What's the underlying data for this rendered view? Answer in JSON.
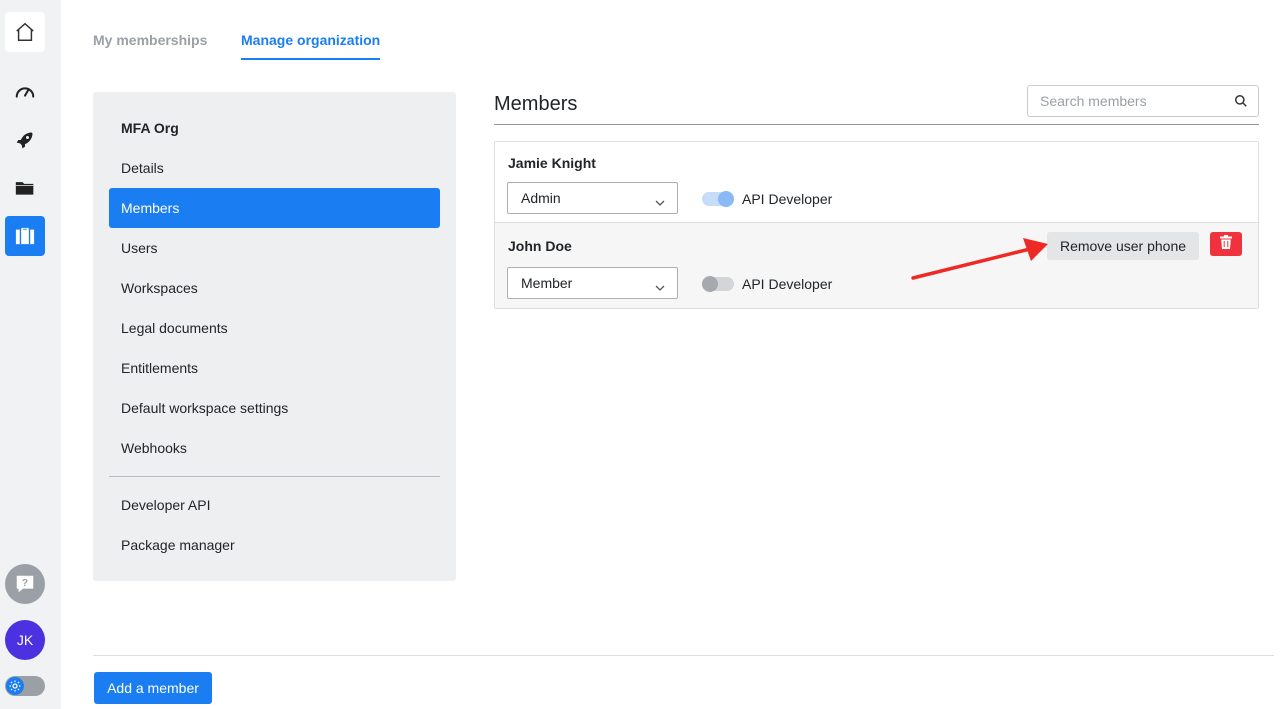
{
  "rail": {
    "icons": [
      "home-icon",
      "speedometer-icon",
      "rocket-icon",
      "folder-icon",
      "briefcase-icon"
    ],
    "help_icon": "question-bubble-icon",
    "avatar_initials": "JK",
    "theme_icon": "sun-icon",
    "accent_color": "#1a7ef2"
  },
  "tabs": [
    {
      "label": "My memberships",
      "active": false
    },
    {
      "label": "Manage organization",
      "active": true
    }
  ],
  "nav": {
    "org_name": "MFA Org",
    "items": [
      "Details",
      "Members",
      "Users",
      "Workspaces",
      "Legal documents",
      "Entitlements",
      "Default workspace settings",
      "Webhooks"
    ],
    "active_item": "Members",
    "secondary_items": [
      "Developer API",
      "Package manager"
    ]
  },
  "members": {
    "title": "Members",
    "search_placeholder": "Search members",
    "rows": [
      {
        "name": "Jamie Knight",
        "role": "Admin",
        "toggle_label": "API Developer",
        "api_developer": true
      },
      {
        "name": "John Doe",
        "role": "Member",
        "toggle_label": "API Developer",
        "api_developer": false,
        "action_label": "Remove user phone",
        "delete_icon": "trash-icon"
      }
    ]
  },
  "footer": {
    "add_member_label": "Add a member"
  }
}
